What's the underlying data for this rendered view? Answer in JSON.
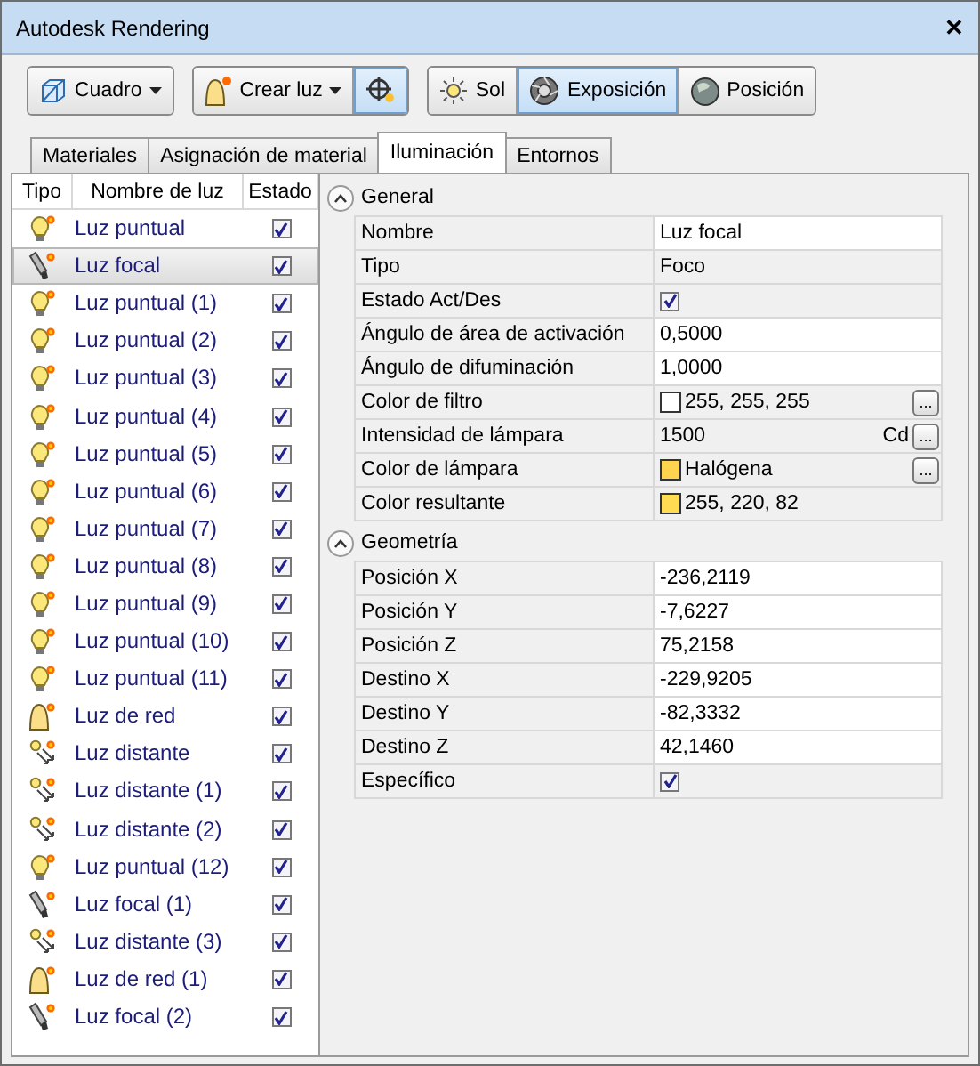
{
  "window": {
    "title": "Autodesk Rendering",
    "close": "✕"
  },
  "toolbar": [
    {
      "buttons": [
        {
          "label": "Cuadro",
          "dropdown": true,
          "selected": false
        }
      ]
    },
    {
      "buttons": [
        {
          "label": "Crear luz",
          "dropdown": true,
          "selected": false
        },
        {
          "dropdown": false,
          "selected": true
        }
      ]
    },
    {
      "buttons": [
        {
          "label": "Sol",
          "dropdown": false,
          "selected": false
        },
        {
          "label": "Exposición",
          "dropdown": false,
          "selected": true
        },
        {
          "label": "Posición",
          "dropdown": false,
          "selected": false
        }
      ]
    }
  ],
  "tabs": [
    {
      "label": "Materiales",
      "selected": false
    },
    {
      "label": "Asignación de material",
      "selected": false
    },
    {
      "label": "Iluminación",
      "selected": true
    },
    {
      "label": "Entornos",
      "selected": false
    }
  ],
  "lights": {
    "columns": [
      "Tipo",
      "Nombre de luz",
      "Estado"
    ],
    "rows": [
      {
        "kind": "point",
        "name": "Luz puntual",
        "on": true,
        "selected": false
      },
      {
        "kind": "spot",
        "name": "Luz focal",
        "on": true,
        "selected": true
      },
      {
        "kind": "point",
        "name": "Luz puntual (1)",
        "on": true,
        "selected": false
      },
      {
        "kind": "point",
        "name": "Luz puntual (2)",
        "on": true,
        "selected": false
      },
      {
        "kind": "point",
        "name": "Luz puntual (3)",
        "on": true,
        "selected": false
      },
      {
        "kind": "point",
        "name": "Luz puntual (4)",
        "on": true,
        "selected": false
      },
      {
        "kind": "point",
        "name": "Luz puntual (5)",
        "on": true,
        "selected": false
      },
      {
        "kind": "point",
        "name": "Luz puntual (6)",
        "on": true,
        "selected": false
      },
      {
        "kind": "point",
        "name": "Luz puntual (7)",
        "on": true,
        "selected": false
      },
      {
        "kind": "point",
        "name": "Luz puntual (8)",
        "on": true,
        "selected": false
      },
      {
        "kind": "point",
        "name": "Luz puntual (9)",
        "on": true,
        "selected": false
      },
      {
        "kind": "point",
        "name": "Luz puntual (10)",
        "on": true,
        "selected": false
      },
      {
        "kind": "point",
        "name": "Luz puntual (11)",
        "on": true,
        "selected": false
      },
      {
        "kind": "web",
        "name": "Luz de red",
        "on": true,
        "selected": false
      },
      {
        "kind": "distant",
        "name": "Luz distante",
        "on": true,
        "selected": false
      },
      {
        "kind": "distant",
        "name": "Luz distante (1)",
        "on": true,
        "selected": false
      },
      {
        "kind": "distant",
        "name": "Luz distante (2)",
        "on": true,
        "selected": false
      },
      {
        "kind": "point",
        "name": "Luz puntual (12)",
        "on": true,
        "selected": false
      },
      {
        "kind": "spot",
        "name": "Luz focal (1)",
        "on": true,
        "selected": false
      },
      {
        "kind": "distant",
        "name": "Luz distante (3)",
        "on": true,
        "selected": false
      },
      {
        "kind": "web",
        "name": "Luz de red (1)",
        "on": true,
        "selected": false
      },
      {
        "kind": "spot",
        "name": "Luz focal (2)",
        "on": true,
        "selected": false
      }
    ]
  },
  "sections": [
    {
      "title": "General",
      "expanded": true,
      "rows": [
        {
          "label": "Nombre",
          "kind": "text",
          "value": "Luz focal",
          "editable": true
        },
        {
          "label": "Tipo",
          "kind": "text",
          "value": "Foco",
          "editable": false
        },
        {
          "label": "Estado Act/Des",
          "kind": "checkbox",
          "checked": true
        },
        {
          "label": "Ángulo de área de activación",
          "kind": "text",
          "value": "0,5000",
          "editable": true
        },
        {
          "label": "Ángulo de difuminación",
          "kind": "text",
          "value": "1,0000",
          "editable": true
        },
        {
          "label": "Color de filtro",
          "kind": "color",
          "color": "#ffffff",
          "value": "255, 255, 255",
          "button": "...",
          "editable": false
        },
        {
          "label": "Intensidad de lámpara",
          "kind": "unit",
          "value": "1500",
          "unit": "Cd",
          "button": "...",
          "editable": false
        },
        {
          "label": "Color de lámpara",
          "kind": "color",
          "color": "#ffd54f",
          "value": "Halógena",
          "button": "...",
          "editable": false
        },
        {
          "label": "Color resultante",
          "kind": "color",
          "color": "#ffdc52",
          "value": "255, 220, 82",
          "editable": false
        }
      ]
    },
    {
      "title": "Geometría",
      "expanded": true,
      "rows": [
        {
          "label": "Posición X",
          "kind": "text",
          "value": "-236,2119",
          "editable": true
        },
        {
          "label": "Posición Y",
          "kind": "text",
          "value": "-7,6227",
          "editable": true
        },
        {
          "label": "Posición Z",
          "kind": "text",
          "value": "75,2158",
          "editable": true
        },
        {
          "label": "Destino X",
          "kind": "text",
          "value": "-229,9205",
          "editable": true
        },
        {
          "label": "Destino Y",
          "kind": "text",
          "value": "-82,3332",
          "editable": true
        },
        {
          "label": "Destino Z",
          "kind": "text",
          "value": "42,1460",
          "editable": true
        },
        {
          "label": "Específico",
          "kind": "checkbox",
          "checked": true
        }
      ]
    }
  ]
}
